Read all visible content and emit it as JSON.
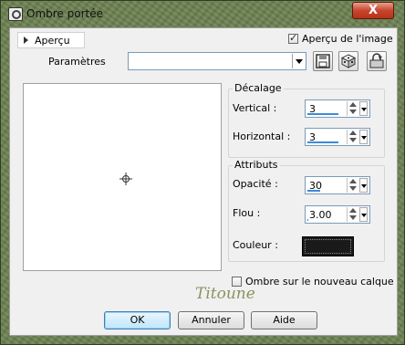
{
  "window": {
    "title": "Ombre portée",
    "close_label": "X"
  },
  "preview_tab": {
    "label": "Aperçu"
  },
  "preview_on_image": {
    "label": "Aperçu de l'image",
    "checked": true
  },
  "presets": {
    "label": "Paramètres",
    "value": ""
  },
  "offset_group": {
    "title": "Décalage",
    "vertical": {
      "label": "Vertical :",
      "value": "3"
    },
    "horizontal": {
      "label": "Horizontal :",
      "value": "3"
    }
  },
  "attributes_group": {
    "title": "Attributs",
    "opacity": {
      "label": "Opacité :",
      "value": "30"
    },
    "blur": {
      "label": "Flou :",
      "value": "3.00"
    },
    "color": {
      "label": "Couleur :",
      "value": "#1a1a1a"
    }
  },
  "new_layer": {
    "label": "Ombre sur le nouveau calque",
    "checked": false
  },
  "watermark": "Titoune",
  "buttons": {
    "ok": "OK",
    "cancel": "Annuler",
    "help": "Aide"
  },
  "icons": [
    "camera-icon",
    "save-preset-icon",
    "randomize-icon",
    "reset-icon",
    "move-cursor-icon"
  ]
}
